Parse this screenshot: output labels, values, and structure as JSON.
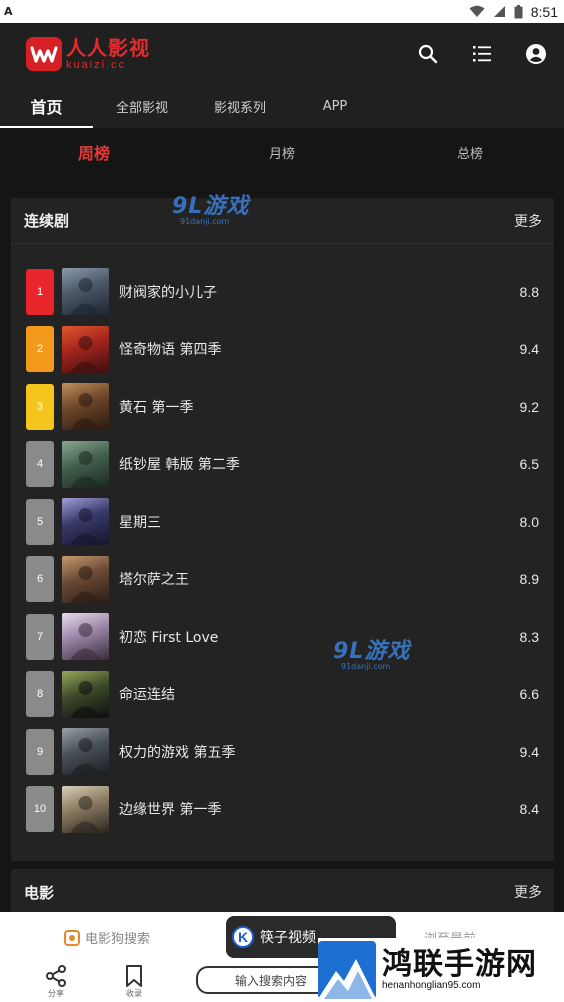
{
  "status_bar": {
    "time": "8:51",
    "left_icon": "A"
  },
  "header": {
    "logo_cn": "人人影视",
    "logo_en": "kuaizi.cc",
    "icons": [
      "search-icon",
      "list-icon",
      "account-icon"
    ]
  },
  "tabs": [
    {
      "label": "首页",
      "active": true
    },
    {
      "label": "全部影视",
      "active": false
    },
    {
      "label": "影视系列",
      "active": false
    },
    {
      "label": "APP",
      "active": false
    }
  ],
  "subtabs": [
    {
      "label": "周榜",
      "active": true
    },
    {
      "label": "月榜",
      "active": false
    },
    {
      "label": "总榜",
      "active": false
    }
  ],
  "series_card": {
    "title": "连续剧",
    "more": "更多",
    "items": [
      {
        "rank": "1",
        "name": "财阀家的小儿子",
        "score": "8.8",
        "badge_color": "#e8262c"
      },
      {
        "rank": "2",
        "name": "怪奇物语 第四季",
        "score": "9.4",
        "badge_color": "#f39a1c"
      },
      {
        "rank": "3",
        "name": "黄石 第一季",
        "score": "9.2",
        "badge_color": "#f6c51d"
      },
      {
        "rank": "4",
        "name": "纸钞屋 韩版 第二季",
        "score": "6.5",
        "badge_color": "#8a8a8a"
      },
      {
        "rank": "5",
        "name": "星期三",
        "score": "8.0",
        "badge_color": "#8a8a8a"
      },
      {
        "rank": "6",
        "name": "塔尔萨之王",
        "score": "8.9",
        "badge_color": "#8a8a8a"
      },
      {
        "rank": "7",
        "name": "初恋 First Love",
        "score": "8.3",
        "badge_color": "#8a8a8a"
      },
      {
        "rank": "8",
        "name": "命运连结",
        "score": "6.6",
        "badge_color": "#8a8a8a"
      },
      {
        "rank": "9",
        "name": "权力的游戏 第五季",
        "score": "9.4",
        "badge_color": "#8a8a8a"
      },
      {
        "rank": "10",
        "name": "边缘世界 第一季",
        "score": "8.4",
        "badge_color": "#8a8a8a"
      }
    ]
  },
  "movie_card": {
    "title": "电影",
    "more": "更多"
  },
  "watermarks": {
    "main": "9L游戏",
    "sub": "91danji.com"
  },
  "bottom_bar": {
    "search_app": "电影狗搜索",
    "video_app": "筷子视频",
    "recent": "浏至最前",
    "search_placeholder": "输入搜索内容",
    "share_label": "分享",
    "bookmark_label": "收录"
  },
  "brand": {
    "name": "鸿联手游网",
    "url": "henanhonglian95.com"
  }
}
